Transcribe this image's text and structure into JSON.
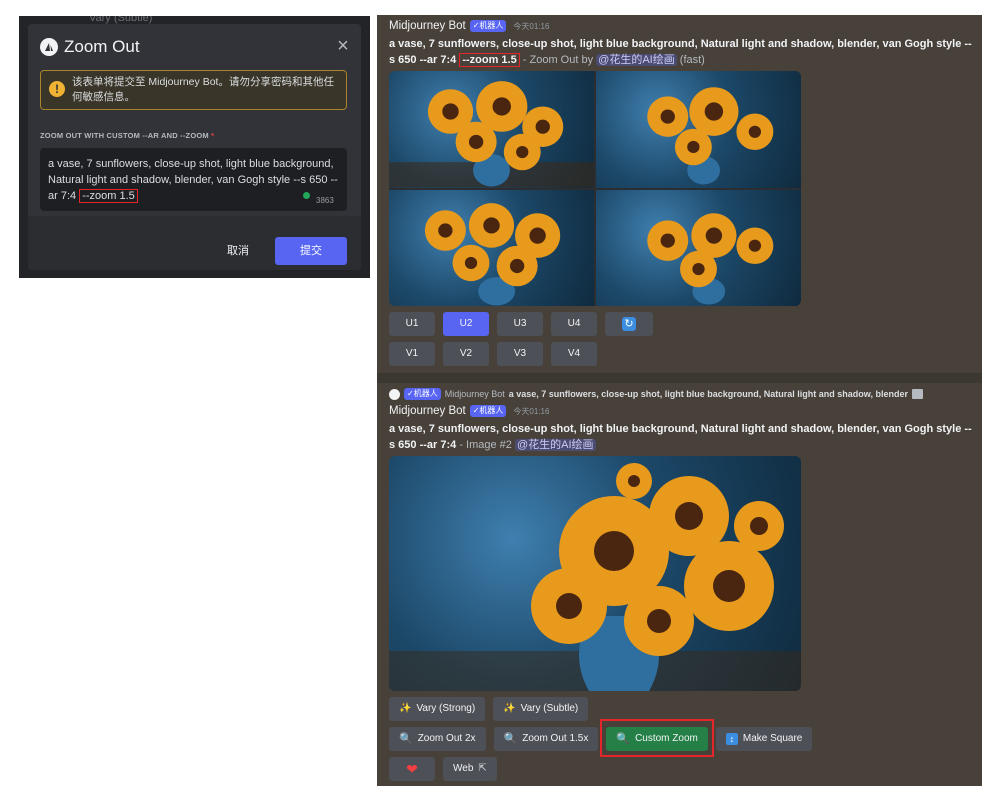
{
  "modal": {
    "background_peek": "Vary (Subtle)",
    "title": "Zoom Out",
    "warning": "该表单将提交至 Midjourney Bot。请勿分享密码和其他任何敏感信息。",
    "field_label": "ZOOM OUT WITH CUSTOM --AR AND --ZOOM",
    "field_required": "*",
    "prompt_main": "a vase, 7 sunflowers, close-up shot, light blue background, Natural light and shadow, blender, van Gogh style --s 650 --ar 7:4 ",
    "prompt_highlight": "--zoom 1.5",
    "char_count": "3863",
    "cancel_label": "取消",
    "submit_label": "提交"
  },
  "message1": {
    "author": "Midjourney Bot",
    "bot_tag": "✓机器人",
    "timestamp": "今天01:16",
    "prompt_bold": "a vase, 7 sunflowers, close-up shot, light blue background, Natural light and shadow, blender, van Gogh style --s 650 --ar 7:4 ",
    "prompt_highlight": "--zoom 1.5",
    "suffix": " - Zoom Out by ",
    "mention": "@花生的AI绘画",
    "mode": " (fast)",
    "upscale_buttons": [
      "U1",
      "U2",
      "U3",
      "U4"
    ],
    "variation_buttons": [
      "V1",
      "V2",
      "V3",
      "V4"
    ],
    "active_button": "U2"
  },
  "reply": {
    "bot_tag": "✓机器人",
    "author": "Midjourney Bot",
    "text": "a vase, 7 sunflowers, close-up shot, light blue background, Natural light and shadow, blender"
  },
  "message2": {
    "author": "Midjourney Bot",
    "bot_tag": "✓机器人",
    "timestamp": "今天01:16",
    "prompt_bold": "a vase, 7 sunflowers, close-up shot, light blue background, Natural light and shadow, blender, van Gogh style --s 650 --ar 7:4",
    "suffix": " - Image #2 ",
    "mention": "@花生的AI绘画",
    "buttons": {
      "vary_strong": "Vary (Strong)",
      "vary_subtle": "Vary (Subtle)",
      "zoom_out_2x": "Zoom Out 2x",
      "zoom_out_15x": "Zoom Out 1.5x",
      "custom_zoom": "Custom Zoom",
      "make_square": "Make Square",
      "web": "Web"
    }
  },
  "icons": {
    "warning": "!",
    "close": "×",
    "refresh": "↻",
    "magnify": "🔍",
    "sparkle": "✨",
    "square": "↕",
    "heart": "❤",
    "external": "⇱"
  },
  "colors": {
    "blurple": "#5865f2",
    "green": "#248046",
    "highlight_red": "#e4262b"
  }
}
